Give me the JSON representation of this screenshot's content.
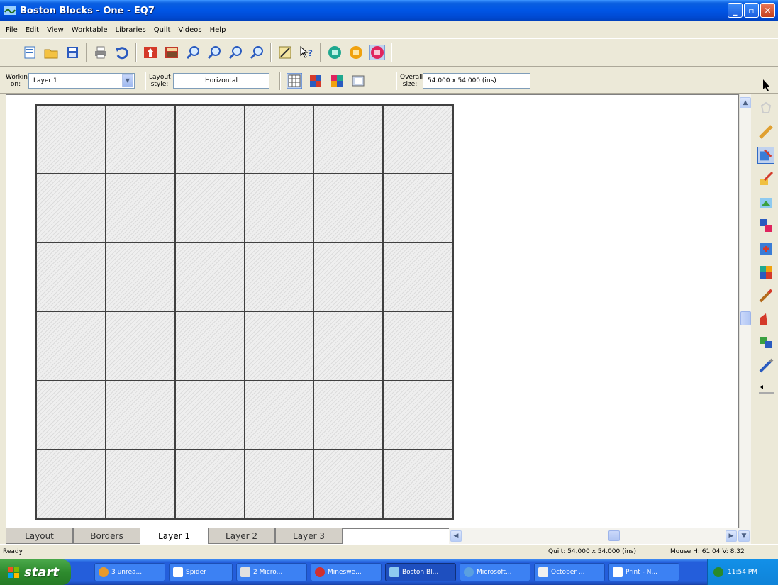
{
  "window": {
    "title": "Boston Blocks - One - EQ7",
    "controls": [
      "minimize",
      "maximize",
      "close"
    ]
  },
  "menu": [
    "File",
    "Edit",
    "View",
    "Worktable",
    "Libraries",
    "Quilt",
    "Videos",
    "Help"
  ],
  "toolbar": {
    "icons": [
      "new-icon",
      "open-icon",
      "save-icon",
      "print-icon",
      "undo-icon",
      "add-to-sketchbook-icon",
      "view-sketchbook-icon",
      "zoom-in-icon",
      "zoom-out-icon",
      "refresh-icon",
      "fit-to-worktable-icon",
      "rulers-icon",
      "help-icon",
      "view-quilt-icon",
      "view-block-icon",
      "view-image-icon"
    ]
  },
  "props": {
    "working_on_label": "Working on:",
    "working_on_value": "Layer 1",
    "layout_style_label": "Layout style:",
    "layout_style_value": "Horizontal",
    "overall_size_label": "Overall size:",
    "overall_size_value": "54.000 x 54.000 (ins)"
  },
  "quilt": {
    "columns": 6,
    "rows": 6
  },
  "tabs": [
    {
      "label": "Layout",
      "active": false
    },
    {
      "label": "Borders",
      "active": false
    },
    {
      "label": "Layer 1",
      "active": true
    },
    {
      "label": "Layer 2",
      "active": false
    },
    {
      "label": "Layer 3",
      "active": false
    }
  ],
  "status": {
    "left": "Ready",
    "quilt": "Quilt: 54.000 x 54.000 (ins)",
    "mouse": "Mouse H: 61.04 V: 8.32"
  },
  "taskbar": {
    "start": "start",
    "tasks": [
      {
        "label": "3 unrea...",
        "active": false
      },
      {
        "label": "Spider",
        "active": false
      },
      {
        "label": "2 Micro...",
        "active": false
      },
      {
        "label": "Mineswe...",
        "active": false
      },
      {
        "label": "Boston Bl...",
        "active": true
      },
      {
        "label": "Microsoft...",
        "active": false
      },
      {
        "label": "October ...",
        "active": false
      },
      {
        "label": "Print - N...",
        "active": false
      }
    ],
    "clock": "11:54 PM"
  }
}
